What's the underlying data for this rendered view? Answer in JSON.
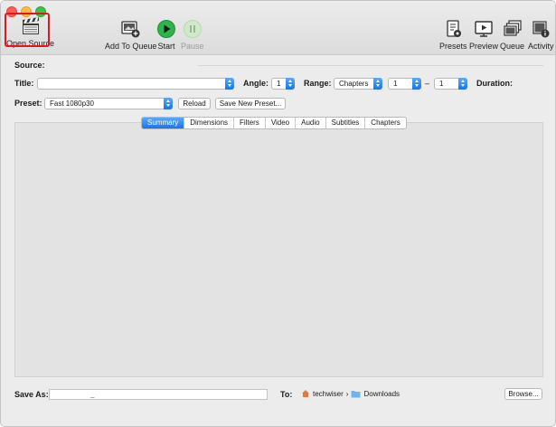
{
  "toolbar": {
    "open_source": "Open Source",
    "add_to_queue": "Add To Queue",
    "start": "Start",
    "pause": "Pause",
    "presets": "Presets",
    "preview": "Preview",
    "queue": "Queue",
    "activity": "Activity"
  },
  "source": {
    "label": "Source:"
  },
  "title_row": {
    "title_label": "Title:",
    "title_value": "",
    "angle_label": "Angle:",
    "angle_value": "1",
    "range_label": "Range:",
    "range_mode": "Chapters",
    "range_start": "1",
    "range_dash": "–",
    "range_end": "1",
    "duration_label": "Duration:"
  },
  "preset_row": {
    "preset_label": "Preset:",
    "preset_value": "Fast 1080p30",
    "reload": "Reload",
    "save_new_preset": "Save New Preset..."
  },
  "tabs": [
    "Summary",
    "Dimensions",
    "Filters",
    "Video",
    "Audio",
    "Subtitles",
    "Chapters"
  ],
  "active_tab": "Summary",
  "bottom": {
    "save_as_label": "Save As:",
    "save_as_value": "_",
    "to_label": "To:",
    "path_user": "techwiser",
    "path_separator": "›",
    "path_folder": "Downloads",
    "browse": "Browse..."
  },
  "colors": {
    "accent": "#1b73e8",
    "highlight_box": "#e8141c",
    "start_green": "#2fb44a"
  }
}
